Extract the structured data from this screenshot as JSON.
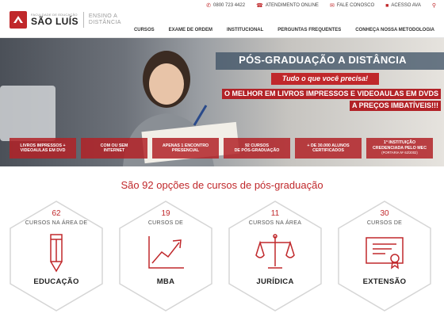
{
  "topbar": {
    "links": [
      {
        "icon": "phone-icon",
        "glyph": "✆",
        "label": "0800 723 4422"
      },
      {
        "icon": "headset-icon",
        "glyph": "☎",
        "label": "ATENDIMENTO ONLINE"
      },
      {
        "icon": "mail-icon",
        "glyph": "✉",
        "label": "FALE CONOSCO"
      },
      {
        "icon": "lock-icon",
        "glyph": "■",
        "label": "ACESSO AVA"
      },
      {
        "icon": "search-icon",
        "glyph": "⚲",
        "label": ""
      }
    ]
  },
  "logo": {
    "small": "FACULDADE DE EDUCAÇÃO",
    "name": "SÃO LUÍS",
    "sub1": "ENSINO A",
    "sub2": "DISTÂNCIA"
  },
  "nav": [
    "CURSOS",
    "EXAME DE ORDEM",
    "INSTITUCIONAL",
    "PERGUNTAS FREQUENTES",
    "CONHEÇA NOSSA METODOLOGIA"
  ],
  "hero": {
    "title": "PÓS-GRADUAÇÃO A DISTÂNCIA",
    "tagline": "Tudo o que você precisa!",
    "sub_line1": "O MELHOR EM LIVROS IMPRESSOS E VIDEOAULAS EM DVDS",
    "sub_line2": "A PREÇOS IMBATÍVEIS!!!",
    "features": [
      {
        "line1": "LIVROS IMPRESSOS +",
        "line2": "VIDEOAULAS EM DVD",
        "note": ""
      },
      {
        "line1": "COM OU SEM",
        "line2": "INTERNET",
        "note": ""
      },
      {
        "line1": "APENAS 1 ENCONTRO",
        "line2": "PRESENCIAL",
        "note": ""
      },
      {
        "line1": "92 CURSOS",
        "line2": "DE PÓS-GRADUAÇÃO",
        "note": ""
      },
      {
        "line1": "+ DE 30.000 ALUNOS",
        "line2": "CERTIFICADOS",
        "note": ""
      },
      {
        "line1": "1ª INSTITUIÇÃO",
        "line2": "CREDENCIADA PELO MEC",
        "note": "(PORTARIA Nº 62/2002)"
      }
    ]
  },
  "section": {
    "title": "São 92 opções de cursos de pós-graduação"
  },
  "cards": [
    {
      "count": "62",
      "prefix": "CURSOS NA ÁREA DE",
      "name": "EDUCAÇÃO",
      "icon": "pencil-icon"
    },
    {
      "count": "19",
      "prefix": "CURSOS DE",
      "name": "MBA",
      "icon": "growth-chart-icon"
    },
    {
      "count": "11",
      "prefix": "CURSOS NA ÁREA",
      "name": "JURÍDICA",
      "icon": "scales-icon"
    },
    {
      "count": "30",
      "prefix": "CURSOS DE",
      "name": "EXTENSÃO",
      "icon": "certificate-icon"
    }
  ],
  "colors": {
    "brand_red": "#c0282b",
    "hero_overlay": "#b22227"
  }
}
